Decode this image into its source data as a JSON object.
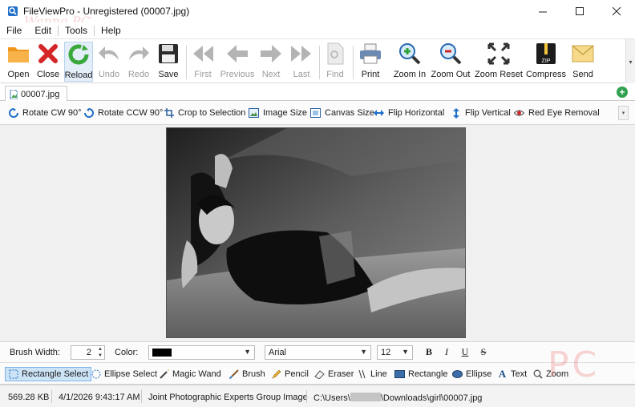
{
  "window": {
    "title": "FileViewPro - Unregistered (00007.jpg)",
    "controls": [
      "minimize",
      "maximize",
      "close"
    ]
  },
  "watermarks": {
    "top_left": "Wanna PC",
    "bottom_right": "PC"
  },
  "menu": [
    "File",
    "Edit",
    "Tools",
    "Help"
  ],
  "toolbar": {
    "open": "Open",
    "close": "Close",
    "reload": "Reload",
    "undo": "Undo",
    "redo": "Redo",
    "save": "Save",
    "first": "First",
    "previous": "Previous",
    "next": "Next",
    "last": "Last",
    "find": "Find",
    "print": "Print",
    "zoom_in": "Zoom In",
    "zoom_out": "Zoom Out",
    "zoom_reset": "Zoom Reset",
    "compress": "Compress",
    "send": "Send",
    "disabled": [
      "Undo",
      "Redo",
      "First",
      "Previous",
      "Next",
      "Last",
      "Find"
    ]
  },
  "tabs": [
    {
      "label": "00007.jpg",
      "active": true
    }
  ],
  "edit_toolbar": {
    "rotate_cw": "Rotate CW 90°",
    "rotate_ccw": "Rotate CCW 90°",
    "crop": "Crop to Selection",
    "image_size": "Image Size",
    "canvas_size": "Canvas Size",
    "flip_h": "Flip Horizontal",
    "flip_v": "Flip Vertical",
    "red_eye": "Red Eye Removal"
  },
  "brush_bar": {
    "brush_width_label": "Brush Width:",
    "brush_width": "2",
    "color_label": "Color:",
    "color_value": "#000000",
    "font": "Arial",
    "font_size": "12",
    "bold": "B",
    "italic": "I",
    "underline": "U",
    "strike": "S"
  },
  "draw_tools": {
    "rect_select": "Rectangle Select",
    "ellipse_select": "Ellipse Select",
    "magic_wand": "Magic Wand",
    "brush": "Brush",
    "pencil": "Pencil",
    "eraser": "Eraser",
    "line": "Line",
    "rectangle": "Rectangle",
    "ellipse": "Ellipse",
    "text": "Text",
    "zoom": "Zoom",
    "active": "Rectangle Select"
  },
  "status": {
    "size": "569.28 KB",
    "date": "4/1/2026 9:43:17 AM",
    "type": "Joint Photographic Experts Group Image",
    "path_prefix": "C:\\Users\\",
    "path_suffix": "\\Downloads\\girl\\00007.jpg"
  },
  "colors": {
    "accent_blue": "#1e6fc9",
    "close_red": "#d42626",
    "reload_green": "#3aa83a",
    "folder_orange": "#f0961e",
    "active_tool_bg": "#cde4f7"
  }
}
